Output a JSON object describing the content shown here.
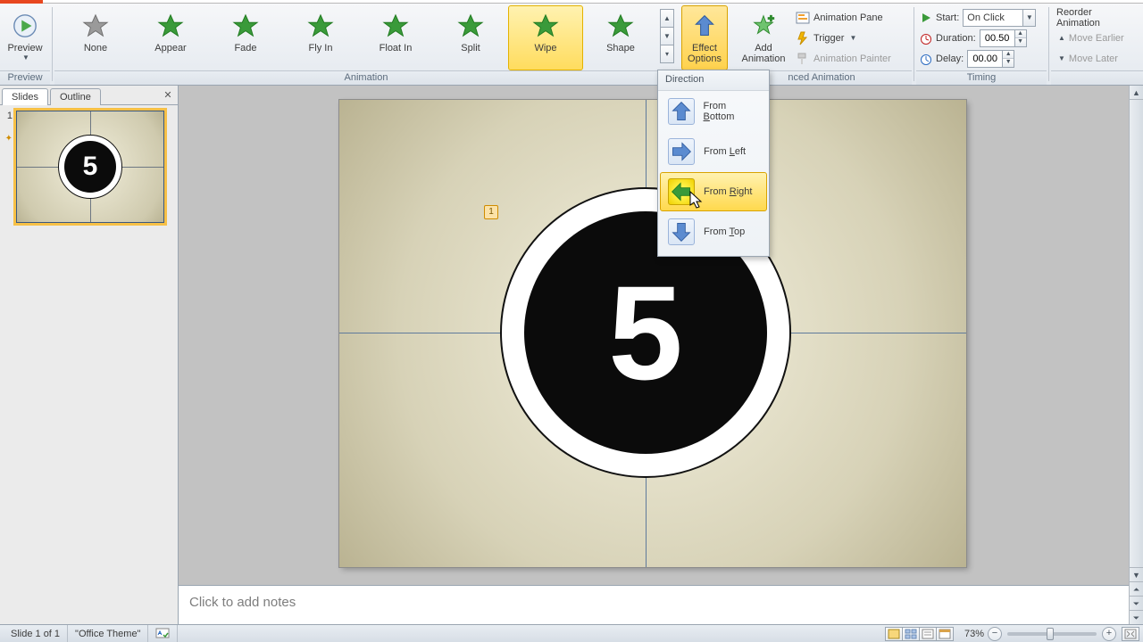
{
  "ribbon": {
    "preview": {
      "label": "Preview",
      "group": "Preview"
    },
    "animations": [
      "None",
      "Appear",
      "Fade",
      "Fly In",
      "Float In",
      "Split",
      "Wipe",
      "Shape"
    ],
    "animation_selected": "Wipe",
    "animation_group": "Animation",
    "effect_options": "Effect\nOptions",
    "add_animation": "Add\nAnimation",
    "adv_group": "nced Animation",
    "anim_pane": "Animation Pane",
    "trigger": "Trigger",
    "painter": "Animation Painter",
    "timing_group": "Timing",
    "start_label": "Start:",
    "start_value": "On Click",
    "duration_label": "Duration:",
    "duration_value": "00.50",
    "delay_label": "Delay:",
    "delay_value": "00.00",
    "reorder": "Reorder Animation",
    "move_earlier": "Move Earlier",
    "move_later": "Move Later"
  },
  "menu": {
    "header": "Direction",
    "items": [
      {
        "label_pre": "From ",
        "u": "B",
        "label_post": "ottom"
      },
      {
        "label_pre": "From ",
        "u": "L",
        "label_post": "eft"
      },
      {
        "label_pre": "From ",
        "u": "R",
        "label_post": "ight"
      },
      {
        "label_pre": "From ",
        "u": "T",
        "label_post": "op"
      }
    ],
    "hover_index": 2
  },
  "left": {
    "tab_slides": "Slides",
    "tab_outline": "Outline",
    "slide_number": "1",
    "countdown": "5"
  },
  "canvas": {
    "countdown": "5",
    "anim_tag": "1"
  },
  "notes": {
    "placeholder": "Click to add notes"
  },
  "status": {
    "slide": "Slide 1 of 1",
    "theme": "\"Office Theme\"",
    "zoom": "73%"
  }
}
